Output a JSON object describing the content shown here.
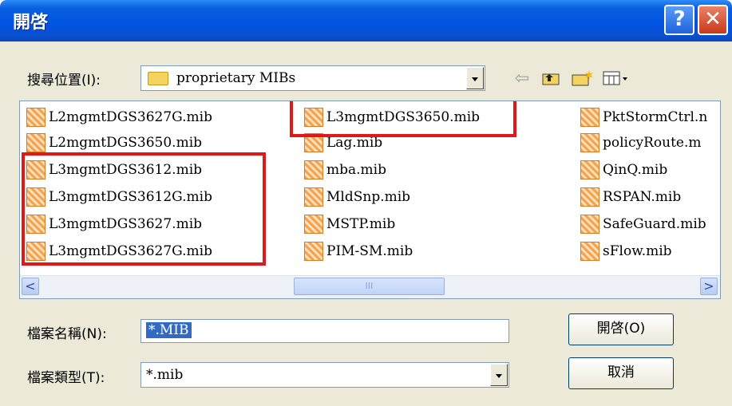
{
  "window": {
    "title": "開啓",
    "help_label": "?",
    "close_label": "✕"
  },
  "location": {
    "label": "搜尋位置(I):",
    "value": "proprietary MIBs"
  },
  "files": {
    "col1": [
      "L2mgmtDGS3627G.mib",
      "L2mgmtDGS3650.mib",
      "L3mgmtDGS3612.mib",
      "L3mgmtDGS3612G.mib",
      "L3mgmtDGS3627.mib",
      "L3mgmtDGS3627G.mib"
    ],
    "col2": [
      "L3mgmtDGS3650.mib",
      "Lag.mib",
      "mba.mib",
      "MldSnp.mib",
      "MSTP.mib",
      "PIM-SM.mib"
    ],
    "col3": [
      "PktStormCtrl.n",
      "policyRoute.m",
      "QinQ.mib",
      "RSPAN.mib",
      "SafeGuard.mib",
      "sFlow.mib"
    ]
  },
  "scrollbar": {
    "left_label": "<",
    "right_label": ">",
    "thumb_label": "III"
  },
  "filename": {
    "label": "檔案名稱(N):",
    "value": "*.MIB"
  },
  "filetype": {
    "label": "檔案類型(T):",
    "value": "*.mib"
  },
  "buttons": {
    "open": "開啓(O)",
    "cancel": "取消"
  },
  "colors": {
    "title_bar": "#0054e3",
    "highlight": "#e01818",
    "dialog_bg": "#ece9d8"
  }
}
